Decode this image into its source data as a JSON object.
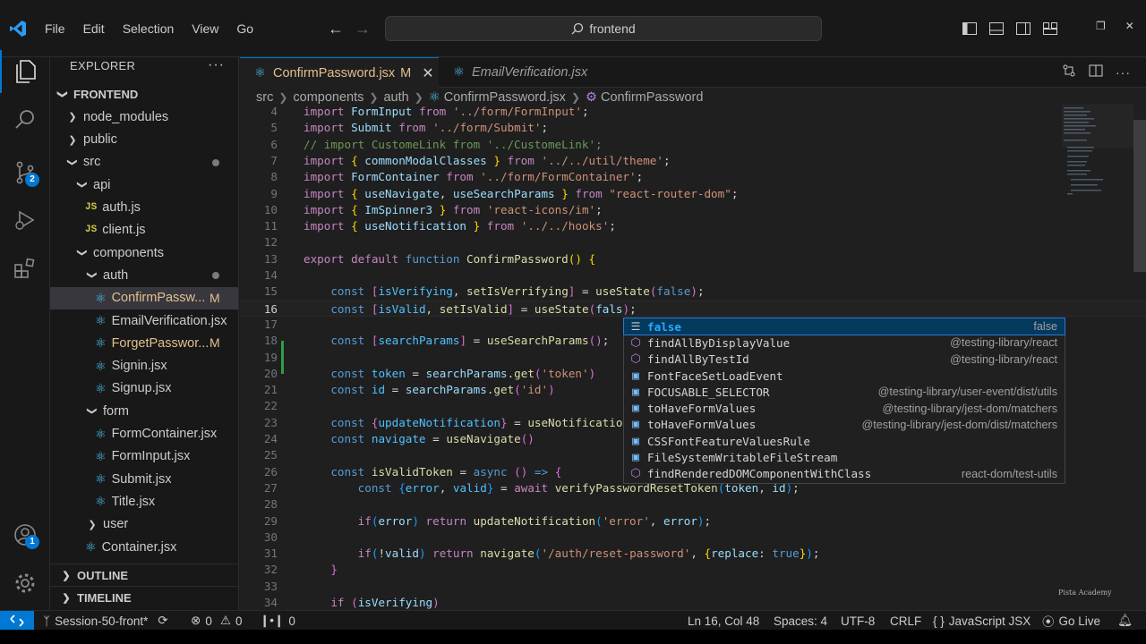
{
  "menu": [
    "File",
    "Edit",
    "Selection",
    "View",
    "Go"
  ],
  "search": {
    "query": "frontend"
  },
  "activity_badges": {
    "source_control": "2",
    "accounts": "1"
  },
  "explorer": {
    "title": "EXPLORER",
    "root": "FRONTEND",
    "items": [
      {
        "label": "node_modules",
        "type": "folder",
        "state": "collapsed"
      },
      {
        "label": "public",
        "type": "folder",
        "state": "collapsed"
      },
      {
        "label": "src",
        "type": "folder",
        "state": "expanded"
      },
      {
        "label": "api",
        "type": "folder",
        "state": "expanded"
      },
      {
        "label": "auth.js",
        "type": "js"
      },
      {
        "label": "client.js",
        "type": "js"
      },
      {
        "label": "components",
        "type": "folder",
        "state": "expanded"
      },
      {
        "label": "auth",
        "type": "folder",
        "state": "expanded"
      },
      {
        "label": "ConfirmPassw...",
        "type": "react",
        "status": "M"
      },
      {
        "label": "EmailVerification.jsx",
        "type": "react"
      },
      {
        "label": "ForgetPasswor...",
        "type": "react",
        "status": "M"
      },
      {
        "label": "Signin.jsx",
        "type": "react"
      },
      {
        "label": "Signup.jsx",
        "type": "react"
      },
      {
        "label": "form",
        "type": "folder",
        "state": "expanded"
      },
      {
        "label": "FormContainer.jsx",
        "type": "react"
      },
      {
        "label": "FormInput.jsx",
        "type": "react"
      },
      {
        "label": "Submit.jsx",
        "type": "react"
      },
      {
        "label": "Title.jsx",
        "type": "react"
      },
      {
        "label": "user",
        "type": "folder",
        "state": "collapsed"
      },
      {
        "label": "Container.jsx",
        "type": "react"
      }
    ],
    "outline": "OUTLINE",
    "timeline": "TIMELINE"
  },
  "tabs": [
    {
      "label": "ConfirmPassword.jsx",
      "status": "M",
      "active": true
    },
    {
      "label": "EmailVerification.jsx",
      "active": false
    }
  ],
  "breadcrumb": [
    "src",
    "components",
    "auth",
    "ConfirmPassword.jsx",
    "ConfirmPassword"
  ],
  "code_lines": [
    {
      "n": "4",
      "html": "<span class='kw'>import</span> <span class='v'>FormInput</span> <span class='kw'>from</span> <span class='s'>'../form/FormInput'</span><span class='p'>;</span>"
    },
    {
      "n": "5",
      "html": "<span class='kw'>import</span> <span class='v'>Submit</span> <span class='kw'>from</span> <span class='s'>'../form/Submit'</span><span class='p'>;</span>"
    },
    {
      "n": "6",
      "html": "<span class='c'>// import CustomeLink from '../CustomeLink';</span>"
    },
    {
      "n": "7",
      "html": "<span class='kw'>import</span> <span class='b1'>{</span> <span class='v'>commonModalClasses</span> <span class='b1'>}</span> <span class='kw'>from</span> <span class='s'>'../../util/theme'</span><span class='p'>;</span>"
    },
    {
      "n": "8",
      "html": "<span class='kw'>import</span> <span class='v'>FormContainer</span> <span class='kw'>from</span> <span class='s'>'../form/FormContainer'</span><span class='p'>;</span>"
    },
    {
      "n": "9",
      "html": "<span class='kw'>import</span> <span class='b1'>{</span> <span class='v'>useNavigate</span><span class='p'>,</span> <span class='v'>useSearchParams</span> <span class='b1'>}</span> <span class='kw'>from</span> <span class='s'>\"react-router-dom\"</span><span class='p'>;</span>"
    },
    {
      "n": "10",
      "html": "<span class='kw'>import</span> <span class='b1'>{</span> <span class='v'>ImSpinner3</span> <span class='b1'>}</span> <span class='kw'>from</span> <span class='s'>'react-icons/im'</span><span class='p'>;</span>"
    },
    {
      "n": "11",
      "html": "<span class='kw'>import</span> <span class='b1'>{</span> <span class='v'>useNotification</span> <span class='b1'>}</span> <span class='kw'>from</span> <span class='s'>'../../hooks'</span><span class='p'>;</span>"
    },
    {
      "n": "12",
      "html": ""
    },
    {
      "n": "13",
      "html": "<span class='kw'>export</span> <span class='kw'>default</span> <span class='k'>function</span> <span class='f'>ConfirmPassword</span><span class='b1'>()</span> <span class='b1'>{</span>"
    },
    {
      "n": "14",
      "html": ""
    },
    {
      "n": "15",
      "html": "    <span class='k'>const</span> <span class='b2'>[</span><span class='cn'>isVerifying</span><span class='p'>,</span> <span class='f'>setIsVerrifying</span><span class='b2'>]</span> <span class='p'>=</span> <span class='f'>useState</span><span class='b2'>(</span><span class='k'>false</span><span class='b2'>)</span><span class='p'>;</span>"
    },
    {
      "n": "16",
      "html": "    <span class='k'>const</span> <span class='b2'>[</span><span class='cn'>isValid</span><span class='p'>,</span> <span class='f'>setIsValid</span><span class='b2'>]</span> <span class='p'>=</span> <span class='f'>useState</span><span class='b2'>(</span><span class='v'>fals</span><span class='b2'>)</span><span class='p'>;</span>"
    },
    {
      "n": "17",
      "html": ""
    },
    {
      "n": "18",
      "html": "    <span class='k'>const</span> <span class='b2'>[</span><span class='cn'>searchParams</span><span class='b2'>]</span> <span class='p'>=</span> <span class='f'>useSearchParams</span><span class='b2'>()</span><span class='p'>;</span>"
    },
    {
      "n": "19",
      "html": ""
    },
    {
      "n": "20",
      "html": "    <span class='k'>const</span> <span class='cn'>token</span> <span class='p'>=</span> <span class='v'>searchParams</span><span class='p'>.</span><span class='f'>get</span><span class='b2'>(</span><span class='s'>'token'</span><span class='b2'>)</span>"
    },
    {
      "n": "21",
      "html": "    <span class='k'>const</span> <span class='cn'>id</span> <span class='p'>=</span> <span class='v'>searchParams</span><span class='p'>.</span><span class='f'>get</span><span class='b2'>(</span><span class='s'>'id'</span><span class='b2'>)</span>"
    },
    {
      "n": "22",
      "html": ""
    },
    {
      "n": "23",
      "html": "    <span class='k'>const</span> <span class='b2'>{</span><span class='cn'>updateNotification</span><span class='b2'>}</span> <span class='p'>=</span> <span class='f'>useNotificatio</span>"
    },
    {
      "n": "24",
      "html": "    <span class='k'>const</span> <span class='cn'>navigate</span> <span class='p'>=</span> <span class='f'>useNavigate</span><span class='b2'>()</span>"
    },
    {
      "n": "25",
      "html": ""
    },
    {
      "n": "26",
      "html": "    <span class='k'>const</span> <span class='f'>isValidToken</span> <span class='p'>=</span> <span class='k'>async</span> <span class='b2'>()</span> <span class='k'>=&gt;</span> <span class='b2'>{</span>"
    },
    {
      "n": "27",
      "html": "        <span class='k'>const</span> <span class='b3'>{</span><span class='cn'>error</span><span class='p'>,</span> <span class='cn'>valid</span><span class='b3'>}</span> <span class='p'>=</span> <span class='kw'>await</span> <span class='f'>verifyPasswordResetToken</span><span class='b3'>(</span><span class='v'>token</span><span class='p'>,</span> <span class='v'>id</span><span class='b3'>)</span><span class='p'>;</span>"
    },
    {
      "n": "28",
      "html": ""
    },
    {
      "n": "29",
      "html": "        <span class='kw'>if</span><span class='b3'>(</span><span class='v'>error</span><span class='b3'>)</span> <span class='kw'>return</span> <span class='f'>updateNotification</span><span class='b3'>(</span><span class='s'>'error'</span><span class='p'>,</span> <span class='v'>error</span><span class='b3'>)</span><span class='p'>;</span>"
    },
    {
      "n": "30",
      "html": ""
    },
    {
      "n": "31",
      "html": "        <span class='kw'>if</span><span class='b3'>(</span><span class='p'>!</span><span class='v'>valid</span><span class='b3'>)</span> <span class='kw'>return</span> <span class='f'>navigate</span><span class='b3'>(</span><span class='s'>'/auth/reset-password'</span><span class='p'>,</span> <span class='b1'>{</span><span class='v'>replace</span><span class='p'>:</span> <span class='k'>true</span><span class='b1'>}</span><span class='b3'>)</span><span class='p'>;</span>"
    },
    {
      "n": "32",
      "html": "    <span class='b2'>}</span>"
    },
    {
      "n": "33",
      "html": ""
    },
    {
      "n": "34",
      "html": "    <span class='kw'>if</span> <span class='b2'>(</span><span class='v'>isVerifying</span><span class='b2'>)</span>"
    }
  ],
  "suggest": [
    {
      "kind": "keyword",
      "label": "false",
      "match": "fals",
      "detail": "false"
    },
    {
      "kind": "symbol",
      "label": "findAllByDisplayValue",
      "detail": "@testing-library/react"
    },
    {
      "kind": "symbol",
      "label": "findAllByTestId",
      "detail": "@testing-library/react"
    },
    {
      "kind": "variable",
      "label": "FontFaceSetLoadEvent",
      "detail": ""
    },
    {
      "kind": "variable",
      "label": "FOCUSABLE_SELECTOR",
      "detail": "@testing-library/user-event/dist/utils"
    },
    {
      "kind": "variable",
      "label": "toHaveFormValues",
      "detail": "@testing-library/jest-dom/matchers"
    },
    {
      "kind": "variable",
      "label": "toHaveFormValues",
      "detail": "@testing-library/jest-dom/dist/matchers"
    },
    {
      "kind": "variable",
      "label": "CSSFontFeatureValuesRule",
      "detail": ""
    },
    {
      "kind": "variable",
      "label": "FileSystemWritableFileStream",
      "detail": ""
    },
    {
      "kind": "symbol",
      "label": "findRenderedDOMComponentWithClass",
      "detail": "react-dom/test-utils"
    }
  ],
  "watermark": "Pista Academy",
  "status": {
    "branch": "Session-50-front*",
    "errors": "0",
    "warnings": "0",
    "ports": "0",
    "position": "Ln 16, Col 48",
    "spaces": "Spaces: 4",
    "encoding": "UTF-8",
    "eol": "CRLF",
    "language": "JavaScript JSX",
    "golive": "Go Live"
  }
}
